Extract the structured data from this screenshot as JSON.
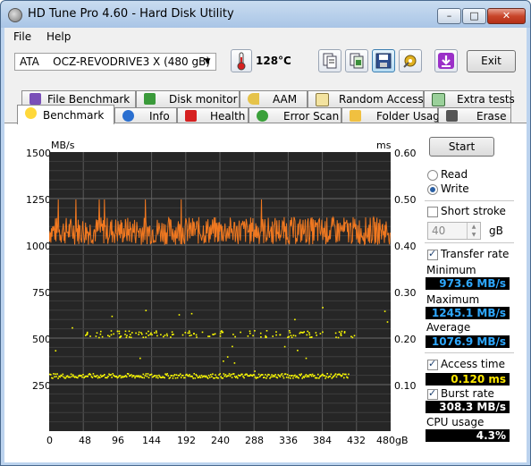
{
  "window": {
    "title": "HD Tune Pro 4.60 - Hard Disk Utility",
    "min": "–",
    "max": "□",
    "close": "✕"
  },
  "menu": {
    "file": "File",
    "help": "Help"
  },
  "toolbar": {
    "drive": "ATA    OCZ-REVODRIVE3 X (480 gB)",
    "temperature": "128°C",
    "exit": "Exit"
  },
  "tabs_top": [
    "File Benchmark",
    "Disk monitor",
    "AAM",
    "Random Access",
    "Extra tests"
  ],
  "tabs_bottom": [
    "Benchmark",
    "Info",
    "Health",
    "Error Scan",
    "Folder Usage",
    "Erase"
  ],
  "chart": {
    "left_unit": "MB/s",
    "right_unit": "ms",
    "left_ticks": [
      "1500",
      "1250",
      "1000",
      "750",
      "500",
      "250"
    ],
    "right_ticks": [
      "0.60",
      "0.50",
      "0.40",
      "0.30",
      "0.20",
      "0.10"
    ],
    "x_ticks": [
      "0",
      "48",
      "96",
      "144",
      "192",
      "240",
      "288",
      "336",
      "384",
      "432",
      "480gB"
    ]
  },
  "chart_data": {
    "type": "line",
    "xlabel": "",
    "ylabel": "MB/s",
    "xlim": [
      0,
      480
    ],
    "ylim": [
      0,
      1500
    ],
    "y2lim": [
      0,
      0.6
    ],
    "series": [
      {
        "values_range": [
          973.6,
          1245.1
        ],
        "average": 1076.9,
        "color": "#f07820"
      },
      {
        "values": [
          0.12,
          0.21
        ],
        "color": "#ffff00"
      }
    ]
  },
  "side": {
    "start": "Start",
    "read": "Read",
    "write": "Write",
    "short_stroke": "Short stroke",
    "stroke_value": "40",
    "stroke_unit": "gB",
    "transfer_rate": "Transfer rate",
    "minimum_label": "Minimum",
    "minimum": "973.6 MB/s",
    "maximum_label": "Maximum",
    "maximum": "1245.1 MB/s",
    "average_label": "Average",
    "average": "1076.9 MB/s",
    "access_time": "Access time",
    "access_value": "0.120 ms",
    "burst_rate": "Burst rate",
    "burst_value": "308.3 MB/s",
    "cpu_label": "CPU usage",
    "cpu_value": "4.3%"
  }
}
